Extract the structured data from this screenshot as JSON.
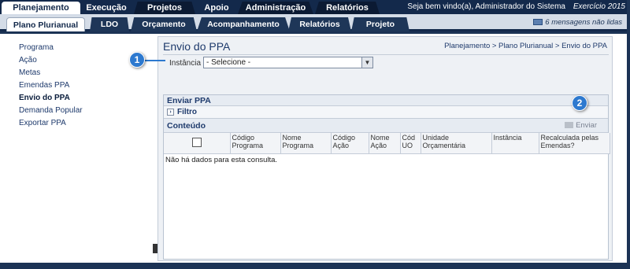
{
  "topnav": {
    "tabs": [
      {
        "label": "Planejamento",
        "active": true
      },
      {
        "label": "Execução",
        "active": false
      },
      {
        "label": "Projetos",
        "active": false
      },
      {
        "label": "Apoio",
        "active": false
      },
      {
        "label": "Administração",
        "active": false
      },
      {
        "label": "Relatórios",
        "active": false
      }
    ],
    "welcome": "Seja bem vindo(a), Administrador do Sistema",
    "exercise": "Exercício 2015"
  },
  "subnav": {
    "tabs": [
      {
        "label": "Plano Plurianual",
        "active": true
      },
      {
        "label": "LDO",
        "active": false
      },
      {
        "label": "Orçamento",
        "active": false
      },
      {
        "label": "Acompanhamento",
        "active": false
      },
      {
        "label": "Relatórios",
        "active": false
      },
      {
        "label": "Projeto",
        "active": false
      }
    ],
    "messages": "6 mensagens não lidas"
  },
  "sidebar": {
    "items": [
      {
        "label": "Programa",
        "active": false
      },
      {
        "label": "Ação",
        "active": false
      },
      {
        "label": "Metas",
        "active": false
      },
      {
        "label": "Emendas PPA",
        "active": false
      },
      {
        "label": "Envio do PPA",
        "active": true
      },
      {
        "label": "Demanda Popular",
        "active": false
      },
      {
        "label": "Exportar PPA",
        "active": false
      }
    ]
  },
  "main": {
    "title": "Envio do PPA",
    "breadcrumb": "Planejamento > Plano Plurianual > Envio do PPA",
    "instancia_label": "Instância",
    "instancia_value": "- Selecione -",
    "panel_title": "Enviar PPA",
    "filter_label": "Filtro",
    "content_label": "Conteúdo",
    "send_button": "Enviar",
    "table": {
      "headers": [
        "",
        "Código Programa",
        "Nome Programa",
        "Código Ação",
        "Nome Ação",
        "Cód UO",
        "Unidade Orçamentária",
        "Instância",
        "Recalculada pelas Emendas?"
      ],
      "empty_message": "Não há dados para esta consulta."
    }
  },
  "callouts": [
    "1",
    "2"
  ],
  "colors": {
    "nav_dark": "#13294b",
    "accent_blue": "#2d79cf"
  }
}
